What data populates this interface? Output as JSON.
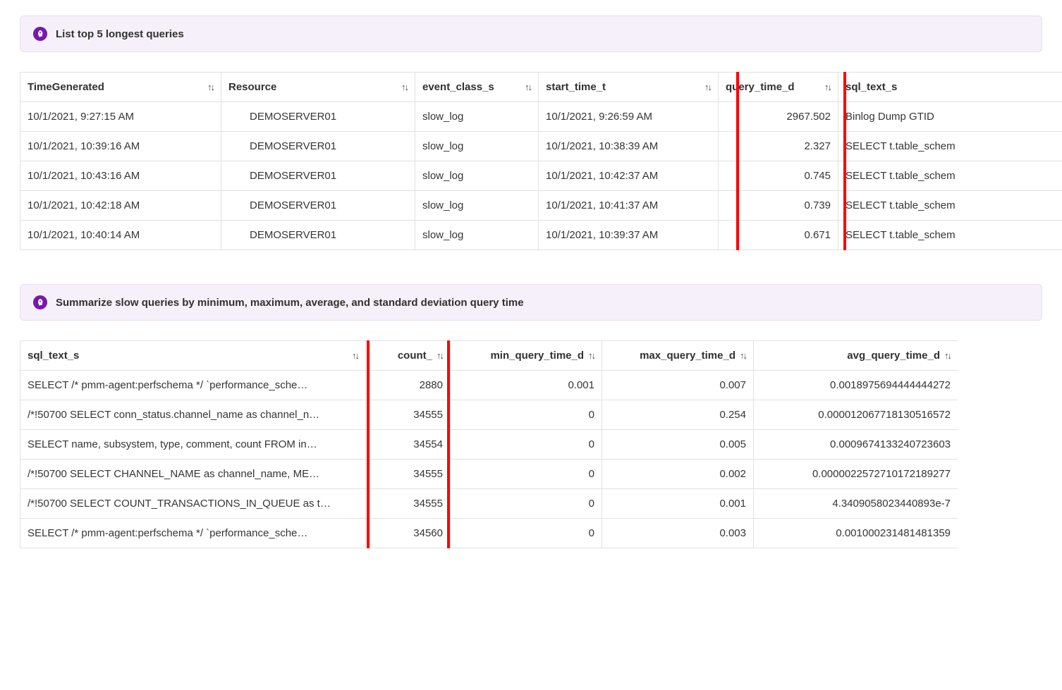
{
  "panel1": {
    "title": "List top 5 longest queries",
    "columns": {
      "time_generated": "TimeGenerated",
      "resource": "Resource",
      "event_class_s": "event_class_s",
      "start_time_t": "start_time_t",
      "query_time_d": "query_time_d",
      "sql_text_s": "sql_text_s"
    },
    "rows": [
      {
        "time_generated": "10/1/2021, 9:27:15 AM",
        "resource": "DEMOSERVER01",
        "event_class_s": "slow_log",
        "start_time_t": "10/1/2021, 9:26:59 AM",
        "query_time_d": "2967.502",
        "sql_text_s": "Binlog Dump GTID"
      },
      {
        "time_generated": "10/1/2021, 10:39:16 AM",
        "resource": "DEMOSERVER01",
        "event_class_s": "slow_log",
        "start_time_t": "10/1/2021, 10:38:39 AM",
        "query_time_d": "2.327",
        "sql_text_s": "SELECT t.table_schem"
      },
      {
        "time_generated": "10/1/2021, 10:43:16 AM",
        "resource": "DEMOSERVER01",
        "event_class_s": "slow_log",
        "start_time_t": "10/1/2021, 10:42:37 AM",
        "query_time_d": "0.745",
        "sql_text_s": "SELECT t.table_schem"
      },
      {
        "time_generated": "10/1/2021, 10:42:18 AM",
        "resource": "DEMOSERVER01",
        "event_class_s": "slow_log",
        "start_time_t": "10/1/2021, 10:41:37 AM",
        "query_time_d": "0.739",
        "sql_text_s": "SELECT t.table_schem"
      },
      {
        "time_generated": "10/1/2021, 10:40:14 AM",
        "resource": "DEMOSERVER01",
        "event_class_s": "slow_log",
        "start_time_t": "10/1/2021, 10:39:37 AM",
        "query_time_d": "0.671",
        "sql_text_s": "SELECT t.table_schem"
      }
    ]
  },
  "panel2": {
    "title": "Summarize slow queries by minimum, maximum, average, and standard deviation query time",
    "columns": {
      "sql_text_s": "sql_text_s",
      "count_": "count_",
      "min_query_time_d": "min_query_time_d",
      "max_query_time_d": "max_query_time_d",
      "avg_query_time_d": "avg_query_time_d"
    },
    "rows": [
      {
        "sql_text_s": "SELECT /* pmm-agent:perfschema */ `performance_sche…",
        "count_": "2880",
        "min_query_time_d": "0.001",
        "max_query_time_d": "0.007",
        "avg_query_time_d": "0.0018975694444444272"
      },
      {
        "sql_text_s": "/*!50700 SELECT conn_status.channel_name as channel_n…",
        "count_": "34555",
        "min_query_time_d": "0",
        "max_query_time_d": "0.254",
        "avg_query_time_d": "0.000012067718130516572"
      },
      {
        "sql_text_s": "SELECT name, subsystem, type, comment, count FROM in…",
        "count_": "34554",
        "min_query_time_d": "0",
        "max_query_time_d": "0.005",
        "avg_query_time_d": "0.0009674133240723603"
      },
      {
        "sql_text_s": "/*!50700 SELECT CHANNEL_NAME as channel_name, ME…",
        "count_": "34555",
        "min_query_time_d": "0",
        "max_query_time_d": "0.002",
        "avg_query_time_d": "0.0000022572710172189277"
      },
      {
        "sql_text_s": "/*!50700 SELECT COUNT_TRANSACTIONS_IN_QUEUE as t…",
        "count_": "34555",
        "min_query_time_d": "0",
        "max_query_time_d": "0.001",
        "avg_query_time_d": "4.3409058023440893e-7"
      },
      {
        "sql_text_s": "SELECT /* pmm-agent:perfschema */ `performance_sche…",
        "count_": "34560",
        "min_query_time_d": "0",
        "max_query_time_d": "0.003",
        "avg_query_time_d": "0.001000231481481359"
      }
    ]
  },
  "sort_glyph": "↑↓"
}
